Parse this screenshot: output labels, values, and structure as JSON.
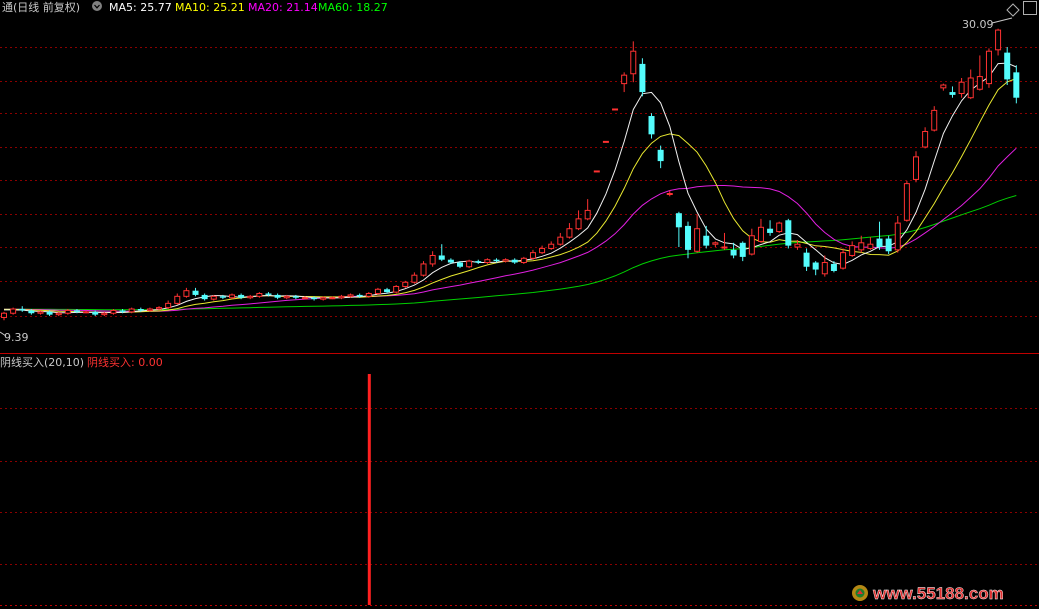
{
  "header": {
    "title": "通(日线 前复权)",
    "ma_legend": [
      {
        "label": "MA5: 25.77",
        "color": "#FFFFFF"
      },
      {
        "label": "MA10: 25.21",
        "color": "#FFFF00"
      },
      {
        "label": "MA20: 21.14",
        "color": "#FF00FF"
      },
      {
        "label": "MA60: 18.27",
        "color": "#00FF00"
      }
    ]
  },
  "indicator": {
    "name": "阴线买入(20,10)",
    "value_label": "阴线买入: 0.00"
  },
  "annotations": {
    "high_label": "30.09",
    "low_label": "9.39"
  },
  "watermark": "www.55188.com",
  "colors": {
    "up": "#FF3232",
    "down": "#54FCFC",
    "grid": "#8B0000",
    "signal": "#FF2020"
  },
  "chart_data": [
    {
      "type": "candlestick",
      "title": "通(日线 前复权)",
      "ylim": [
        8.0,
        31.0
      ],
      "high": 30.09,
      "low": 9.39,
      "series_ma": [
        {
          "name": "MA5",
          "last": 25.77
        },
        {
          "name": "MA10",
          "last": 25.21
        },
        {
          "name": "MA20",
          "last": 21.14
        },
        {
          "name": "MA60",
          "last": 18.27
        }
      ],
      "candles": [
        [
          9.6,
          9.9,
          9.4,
          10.0
        ],
        [
          9.9,
          10.2,
          9.8,
          10.3
        ],
        [
          10.2,
          10.1,
          10.0,
          10.4
        ],
        [
          10.1,
          9.9,
          9.8,
          10.2
        ],
        [
          9.9,
          10.0,
          9.8,
          10.1
        ],
        [
          10.0,
          9.8,
          9.7,
          10.1
        ],
        [
          9.8,
          9.9,
          9.7,
          10.0
        ],
        [
          9.9,
          10.1,
          9.8,
          10.2
        ],
        [
          10.1,
          10.0,
          9.9,
          10.2
        ],
        [
          10.0,
          10.0,
          9.9,
          10.1
        ],
        [
          10.0,
          9.8,
          9.7,
          10.1
        ],
        [
          9.8,
          9.9,
          9.7,
          10.0
        ],
        [
          9.9,
          10.1,
          9.8,
          10.2
        ],
        [
          10.1,
          10.0,
          9.9,
          10.2
        ],
        [
          10.0,
          10.2,
          9.9,
          10.3
        ],
        [
          10.2,
          10.1,
          10.0,
          10.3
        ],
        [
          10.1,
          10.2,
          10.0,
          10.3
        ],
        [
          10.2,
          10.3,
          10.1,
          10.4
        ],
        [
          10.3,
          10.6,
          10.2,
          10.8
        ],
        [
          10.6,
          11.1,
          10.5,
          11.3
        ],
        [
          11.1,
          11.5,
          11.0,
          11.7
        ],
        [
          11.5,
          11.2,
          11.1,
          11.7
        ],
        [
          11.2,
          10.9,
          10.8,
          11.3
        ],
        [
          10.9,
          11.1,
          10.8,
          11.2
        ],
        [
          11.1,
          11.0,
          10.9,
          11.2
        ],
        [
          11.0,
          11.2,
          10.9,
          11.3
        ],
        [
          11.2,
          11.0,
          10.9,
          11.3
        ],
        [
          11.0,
          11.1,
          10.9,
          11.2
        ],
        [
          11.1,
          11.3,
          11.0,
          11.4
        ],
        [
          11.3,
          11.2,
          11.1,
          11.4
        ],
        [
          11.2,
          11.0,
          10.9,
          11.3
        ],
        [
          11.0,
          11.1,
          10.9,
          11.2
        ],
        [
          11.1,
          11.0,
          10.9,
          11.2
        ],
        [
          11.0,
          11.0,
          10.9,
          11.1
        ],
        [
          11.0,
          10.9,
          10.8,
          11.1
        ],
        [
          10.9,
          11.0,
          10.8,
          11.1
        ],
        [
          11.0,
          11.0,
          10.9,
          11.1
        ],
        [
          11.0,
          11.1,
          10.9,
          11.2
        ],
        [
          11.1,
          11.2,
          11.0,
          11.3
        ],
        [
          11.2,
          11.1,
          11.0,
          11.3
        ],
        [
          11.1,
          11.3,
          11.0,
          11.4
        ],
        [
          11.3,
          11.6,
          11.2,
          11.7
        ],
        [
          11.6,
          11.4,
          11.3,
          11.7
        ],
        [
          11.4,
          11.8,
          11.3,
          11.9
        ],
        [
          11.8,
          12.1,
          11.7,
          12.2
        ],
        [
          12.1,
          12.6,
          12.0,
          12.8
        ],
        [
          12.6,
          13.4,
          12.5,
          13.6
        ],
        [
          13.4,
          14.0,
          13.2,
          14.3
        ],
        [
          14.0,
          13.7,
          13.6,
          14.8
        ],
        [
          13.7,
          13.5,
          13.4,
          13.8
        ],
        [
          13.5,
          13.2,
          13.1,
          13.6
        ],
        [
          13.2,
          13.6,
          13.1,
          13.7
        ],
        [
          13.6,
          13.5,
          13.4,
          13.7
        ],
        [
          13.5,
          13.7,
          13.4,
          13.8
        ],
        [
          13.7,
          13.6,
          13.5,
          13.8
        ],
        [
          13.6,
          13.7,
          13.5,
          13.8
        ],
        [
          13.7,
          13.5,
          13.4,
          13.8
        ],
        [
          13.5,
          13.8,
          13.4,
          13.9
        ],
        [
          13.8,
          14.2,
          13.7,
          14.4
        ],
        [
          14.2,
          14.5,
          14.1,
          14.7
        ],
        [
          14.5,
          14.8,
          14.4,
          15.0
        ],
        [
          14.8,
          15.3,
          14.7,
          15.6
        ],
        [
          15.3,
          15.9,
          15.2,
          16.3
        ],
        [
          15.9,
          16.6,
          15.8,
          17.2
        ],
        [
          16.6,
          17.2,
          16.5,
          18.0
        ],
        [
          20.0,
          20.0,
          20.0,
          20.0
        ],
        [
          22.1,
          22.1,
          22.1,
          22.1
        ],
        [
          24.4,
          24.4,
          24.4,
          24.4
        ],
        [
          26.2,
          26.8,
          25.6,
          27.0
        ],
        [
          26.9,
          28.5,
          26.3,
          29.2
        ],
        [
          27.6,
          25.6,
          25.3,
          28.0
        ],
        [
          23.9,
          22.6,
          22.3,
          24.1
        ],
        [
          21.5,
          20.7,
          20.2,
          21.8
        ],
        [
          18.4,
          18.4,
          18.2,
          18.6
        ],
        [
          17.0,
          16.0,
          14.6,
          17.1
        ],
        [
          16.1,
          14.4,
          13.8,
          16.4
        ],
        [
          14.3,
          15.9,
          14.2,
          16.9
        ],
        [
          15.4,
          14.7,
          14.5,
          16.1
        ],
        [
          14.8,
          14.9,
          14.6,
          15.0
        ],
        [
          14.6,
          14.6,
          14.4,
          15.6
        ],
        [
          14.4,
          14.0,
          13.8,
          14.9
        ],
        [
          14.9,
          13.9,
          13.6,
          15.0
        ],
        [
          14.1,
          15.4,
          14.0,
          15.9
        ],
        [
          15.0,
          16.0,
          14.9,
          16.6
        ],
        [
          15.9,
          15.6,
          15.4,
          16.5
        ],
        [
          15.7,
          16.3,
          15.6,
          16.4
        ],
        [
          16.5,
          14.7,
          14.5,
          16.6
        ],
        [
          14.6,
          14.8,
          14.4,
          15.1
        ],
        [
          14.2,
          13.2,
          12.9,
          14.5
        ],
        [
          13.5,
          13.0,
          12.6,
          13.6
        ],
        [
          12.7,
          13.5,
          12.5,
          14.0
        ],
        [
          13.4,
          12.9,
          12.8,
          13.6
        ],
        [
          13.1,
          14.2,
          13.0,
          14.5
        ],
        [
          14.0,
          14.7,
          13.9,
          15.0
        ],
        [
          14.4,
          14.9,
          14.2,
          15.4
        ],
        [
          14.5,
          14.8,
          14.4,
          15.3
        ],
        [
          15.2,
          14.6,
          14.4,
          16.4
        ],
        [
          15.2,
          14.3,
          14.1,
          15.4
        ],
        [
          14.4,
          16.3,
          14.2,
          16.8
        ],
        [
          16.5,
          19.1,
          16.4,
          19.3
        ],
        [
          19.4,
          21.0,
          19.2,
          21.4
        ],
        [
          21.7,
          22.8,
          21.6,
          23.1
        ],
        [
          22.9,
          24.3,
          22.8,
          24.6
        ],
        [
          25.9,
          26.1,
          25.7,
          26.2
        ],
        [
          25.6,
          25.4,
          25.2,
          26.0
        ],
        [
          25.5,
          26.3,
          25.2,
          26.6
        ],
        [
          25.2,
          26.6,
          25.1,
          27.2
        ],
        [
          25.8,
          26.7,
          25.7,
          28.2
        ],
        [
          26.2,
          28.5,
          25.9,
          28.7
        ],
        [
          28.6,
          30.0,
          28.2,
          30.1
        ],
        [
          28.4,
          26.5,
          26.1,
          28.8
        ],
        [
          27.0,
          25.2,
          24.8,
          27.5
        ]
      ],
      "indicator_bars": [
        {
          "index": 40,
          "value": 1
        }
      ]
    }
  ]
}
